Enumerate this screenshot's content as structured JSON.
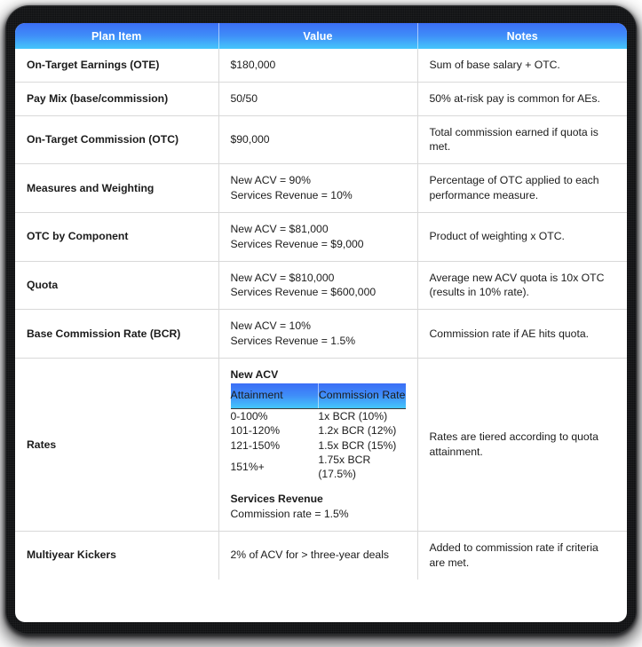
{
  "table": {
    "columns": [
      "Plan Item",
      "Value",
      "Notes"
    ],
    "rows": [
      {
        "item": "On-Target Earnings (OTE)",
        "value_lines": [
          "$180,000"
        ],
        "notes": "Sum of base salary + OTC."
      },
      {
        "item": "Pay Mix (base/commission)",
        "value_lines": [
          "50/50"
        ],
        "notes": "50% at-risk pay is common for AEs."
      },
      {
        "item": "On-Target Commission (OTC)",
        "value_lines": [
          "$90,000"
        ],
        "notes": "Total commission earned if quota is met."
      },
      {
        "item": "Measures and Weighting",
        "value_lines": [
          "New ACV = 90%",
          "Services Revenue = 10%"
        ],
        "notes": "Percentage of OTC applied to each performance measure."
      },
      {
        "item": "OTC by Component",
        "value_lines": [
          "New ACV = $81,000",
          "Services Revenue = $9,000"
        ],
        "notes": "Product of weighting x OTC."
      },
      {
        "item": "Quota",
        "value_lines": [
          "New ACV = $810,000",
          "Services Revenue = $600,000"
        ],
        "notes": "Average new ACV quota is 10x OTC (results in 10% rate)."
      },
      {
        "item": "Base Commission Rate (BCR)",
        "value_lines": [
          "New ACV = 10%",
          "Services Revenue = 1.5%"
        ],
        "notes": "Commission rate if AE hits quota."
      },
      {
        "item": "Multiyear Kickers",
        "value_lines": [
          "2% of ACV for > three-year deals"
        ],
        "notes": "Added to commission rate if criteria are met."
      }
    ],
    "rates_row": {
      "item": "Rates",
      "notes": "Rates are tiered according to quota attainment.",
      "new_acv_title": "New ACV",
      "tier_headers": [
        "Attainment",
        "Commission Rate"
      ],
      "tiers": [
        {
          "attainment": "0-100%",
          "rate": "1x BCR (10%)"
        },
        {
          "attainment": "101-120%",
          "rate": "1.2x BCR (12%)"
        },
        {
          "attainment": "121-150%",
          "rate": "1.5x BCR (15%)"
        },
        {
          "attainment": "151%+",
          "rate": "1.75x BCR (17.5%)"
        }
      ],
      "services_title": "Services Revenue",
      "services_line": "Commission rate = 1.5%"
    }
  },
  "colors": {
    "header_gradient_top": "#3b6ef6",
    "header_gradient_bottom": "#45c6fb",
    "grid_line": "#d9d9d9",
    "text": "#1b1b1b",
    "frame": "#111214",
    "card": "#ffffff"
  }
}
